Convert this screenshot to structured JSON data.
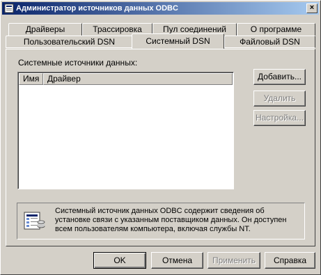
{
  "window": {
    "title": "Администратор источников данных ODBC",
    "close_label": "×"
  },
  "tabs_back_row": [
    "Драйверы",
    "Трассировка",
    "Пул соединений",
    "О программе"
  ],
  "tabs_front_row": [
    "Пользовательский DSN",
    "Системный DSN",
    "Файловый DSN"
  ],
  "active_tab": "Системный DSN",
  "main": {
    "list_label": "Системные источники данных:",
    "columns": [
      "Имя",
      "Драйвер"
    ],
    "rows": []
  },
  "side_buttons": {
    "add": "Добавить...",
    "remove": "Удалить",
    "configure": "Настройка..."
  },
  "info": {
    "icon": "odbc-datasource-icon",
    "lines": [
      "Системный источник данных ODBC содержит сведения об",
      "установке связи с указанным поставщиком данных. Он доступен",
      "всем пользователям компьютера, включая службы NT."
    ]
  },
  "footer_buttons": {
    "ok": "OK",
    "cancel": "Отмена",
    "apply": "Применить",
    "help": "Справка"
  },
  "colors": {
    "titlebar_start": "#0a246a",
    "titlebar_end": "#a6caf0",
    "face": "#d4d0c8",
    "disabled_text": "#808080"
  }
}
